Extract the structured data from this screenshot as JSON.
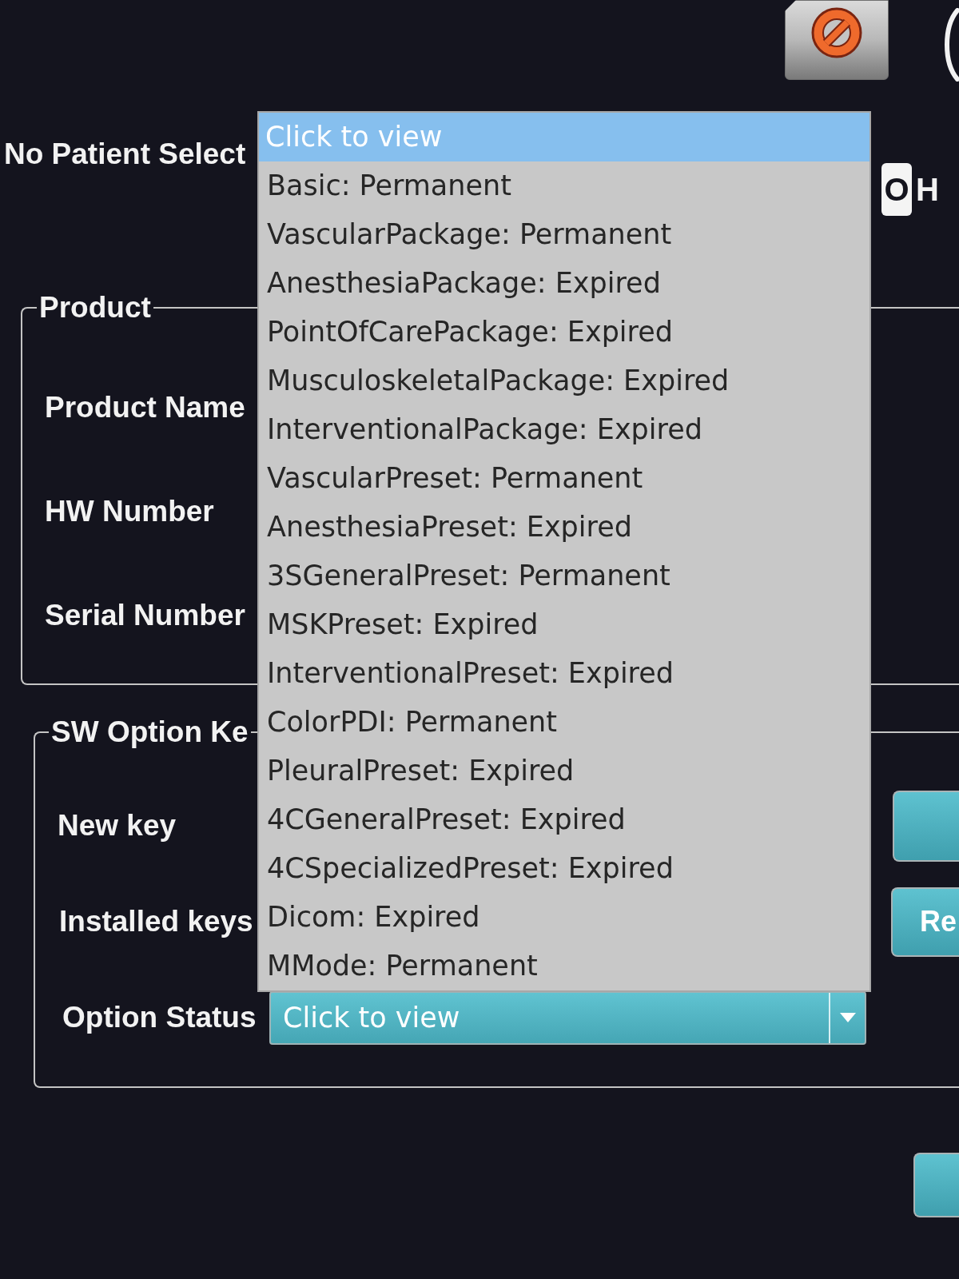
{
  "patient": {
    "title": "No Patient Select"
  },
  "indicators": [
    {
      "kind": "badge",
      "text": "O"
    },
    {
      "kind": "letter",
      "text": "H"
    }
  ],
  "product": {
    "legend": "Product",
    "fields": [
      {
        "label": "Product Name"
      },
      {
        "label": "HW Number"
      },
      {
        "label": "Serial Number"
      }
    ]
  },
  "sw_option_key": {
    "legend": "SW Option Ke",
    "new_key": {
      "label": "New key"
    },
    "installed_keys": {
      "label": "Installed keys",
      "button": "Re"
    },
    "option_status": {
      "label": "Option Status",
      "value": "Click to view",
      "expanded": true,
      "options": [
        {
          "label": "Click to view",
          "selected": true
        },
        {
          "label": "Basic: Permanent",
          "selected": false
        },
        {
          "label": "VascularPackage: Permanent",
          "selected": false
        },
        {
          "label": "AnesthesiaPackage: Expired",
          "selected": false
        },
        {
          "label": "PointOfCarePackage: Expired",
          "selected": false
        },
        {
          "label": "MusculoskeletalPackage: Expired",
          "selected": false
        },
        {
          "label": "InterventionalPackage: Expired",
          "selected": false
        },
        {
          "label": "VascularPreset: Permanent",
          "selected": false
        },
        {
          "label": "AnesthesiaPreset: Expired",
          "selected": false
        },
        {
          "label": "3SGeneralPreset: Permanent",
          "selected": false
        },
        {
          "label": "MSKPreset: Expired",
          "selected": false
        },
        {
          "label": "InterventionalPreset: Expired",
          "selected": false
        },
        {
          "label": "ColorPDI: Permanent",
          "selected": false
        },
        {
          "label": "PleuralPreset: Expired",
          "selected": false
        },
        {
          "label": "4CGeneralPreset: Expired",
          "selected": false
        },
        {
          "label": "4CSpecializedPreset: Expired",
          "selected": false
        },
        {
          "label": "Dicom: Expired",
          "selected": false
        },
        {
          "label": "MMode: Permanent",
          "selected": false
        }
      ]
    }
  }
}
